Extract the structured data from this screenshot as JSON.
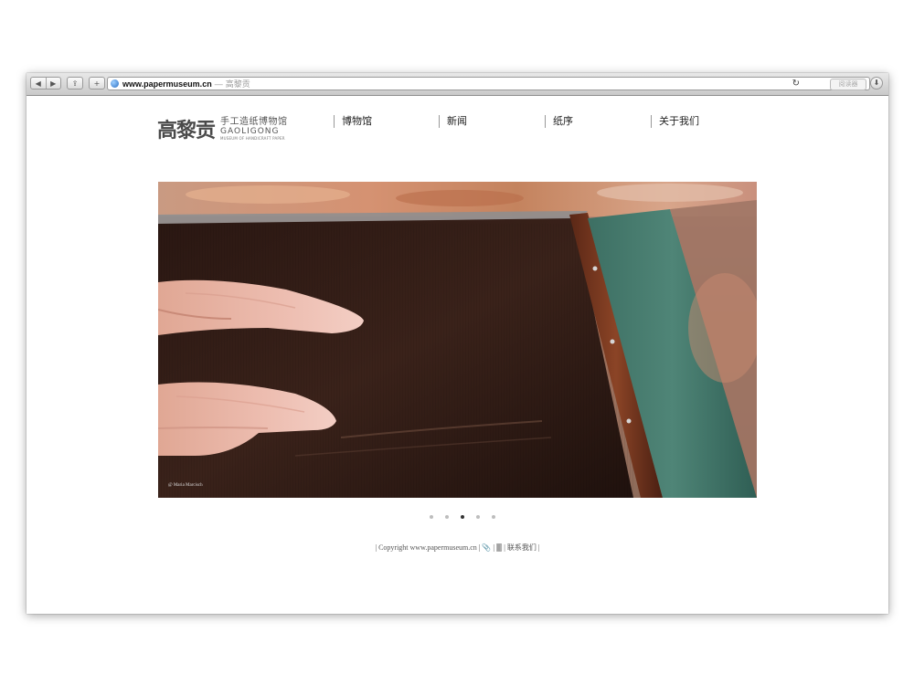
{
  "browser": {
    "url_domain": "www.papermuseum.cn",
    "url_separator": "—",
    "page_title": "高黎贡",
    "reader_label": "阅读器",
    "back_glyph": "◀",
    "forward_glyph": "▶",
    "share_glyph": "⇪",
    "add_glyph": "+",
    "reload_glyph": "↻",
    "download_glyph": "⬇"
  },
  "logo": {
    "mark": "高黎贡",
    "cn_name": "手工造纸博物馆",
    "en_name": "GAOLIGONG",
    "en_sub": "MUSEUM OF HANDICRAFT PAPER"
  },
  "nav": {
    "items": [
      {
        "label": "博物馆"
      },
      {
        "label": "新闻"
      },
      {
        "label": "纸序"
      },
      {
        "label": "关于我们"
      }
    ]
  },
  "hero": {
    "credit": "@ Maria Marcisch"
  },
  "carousel": {
    "count": 5,
    "active_index": 2
  },
  "footer": {
    "text": "| Copyright www.papermuseum.cn | 📎 | 🀫 | 联系我们 |"
  }
}
